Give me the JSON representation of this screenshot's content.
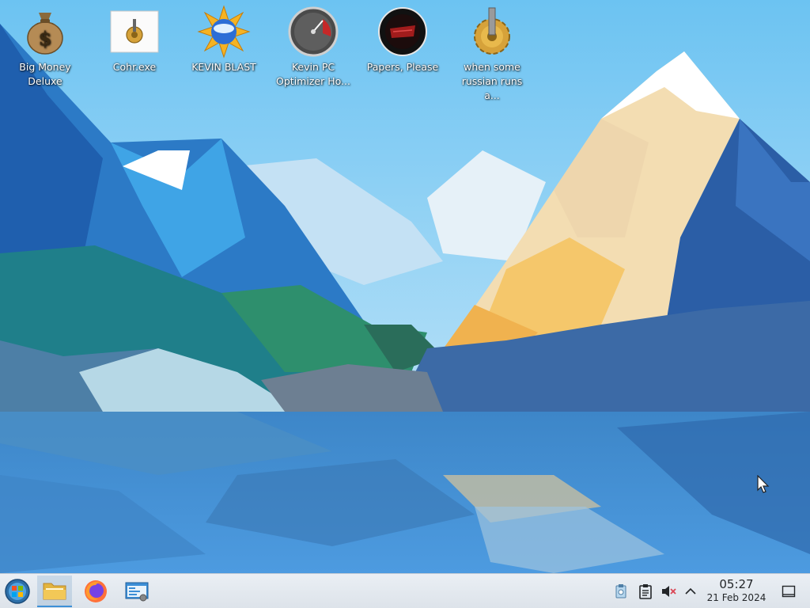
{
  "desktop": {
    "icons": [
      {
        "label_line1": "Big Money",
        "label_line2": "Deluxe",
        "icon": "money-bag-icon"
      },
      {
        "label_line1": "Cohr.exe",
        "label_line2": "",
        "icon": "gear-file-icon"
      },
      {
        "label_line1": "KEVIN BLAST",
        "label_line2": "",
        "icon": "starburst-icon"
      },
      {
        "label_line1": "Kevin PC",
        "label_line2": "Optimizer Ho...",
        "icon": "gauge-icon"
      },
      {
        "label_line1": "Papers, Please",
        "label_line2": "",
        "icon": "seal-icon"
      },
      {
        "label_line1": "when some",
        "label_line2": "russian runs a...",
        "icon": "gear-pillar-icon"
      }
    ]
  },
  "taskbar": {
    "launchers": [
      {
        "name": "application-launcher",
        "icon": "start-orb-icon"
      },
      {
        "name": "file-manager",
        "icon": "folder-icon"
      },
      {
        "name": "firefox",
        "icon": "firefox-icon"
      },
      {
        "name": "system-settings",
        "icon": "settings-window-icon"
      }
    ],
    "tray": [
      "clipboard-notes-icon",
      "clipboard-icon",
      "volume-muted-icon",
      "chevron-up-icon"
    ],
    "clock": {
      "time": "05:27",
      "date": "21 Feb 2024"
    },
    "accent": "#3d8fd6"
  }
}
